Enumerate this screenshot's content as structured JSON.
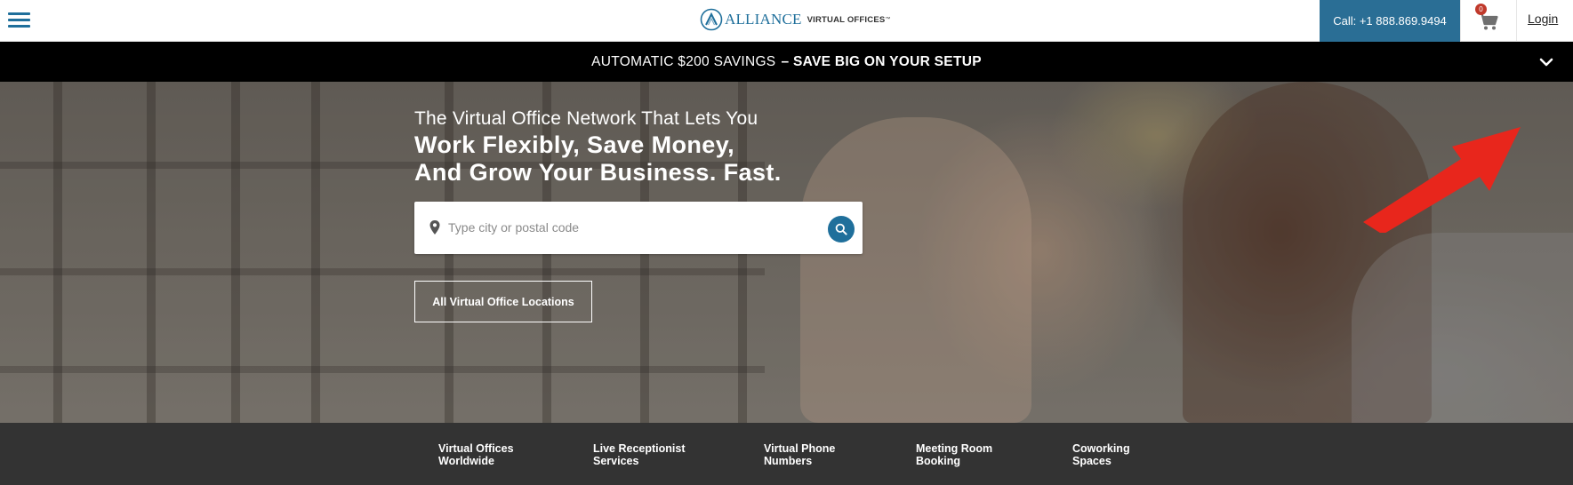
{
  "header": {
    "logo": {
      "brand": "ALLIANCE",
      "sub": "VIRTUAL OFFICES",
      "tm": "™"
    },
    "call_label": "Call: +1 888.869.9494",
    "cart_count": "0",
    "login_label": "Login"
  },
  "promo": {
    "text": "AUTOMATIC $200 SAVINGS",
    "bold": "– SAVE BIG ON YOUR SETUP"
  },
  "hero": {
    "subtitle": "The Virtual Office Network That Lets You",
    "title_line1": "Work Flexibly, Save Money,",
    "title_line2": "And Grow Your Business. Fast.",
    "search": {
      "placeholder": "Type city or postal code",
      "value": ""
    },
    "all_locations_label": "All Virtual Office Locations"
  },
  "services": [
    {
      "line1": "Virtual Offices",
      "line2": "Worldwide"
    },
    {
      "line1": "Live Receptionist",
      "line2": "Services"
    },
    {
      "line1": "Virtual Phone",
      "line2": "Numbers"
    },
    {
      "line1": "Meeting Room",
      "line2": "Booking"
    },
    {
      "line1": "Coworking",
      "line2": "Spaces"
    }
  ],
  "colors": {
    "brand_blue": "#1f6f9b",
    "call_button": "#2a6e95",
    "promo_bg": "#000000",
    "services_bg": "#333333",
    "annotation_arrow": "#e8261c",
    "cart_badge": "#c0392b"
  },
  "icons": {
    "menu": "hamburger-icon",
    "cart": "cart-icon",
    "chevron": "chevron-down-icon",
    "pin": "map-pin-icon",
    "search": "search-icon",
    "annotation": "red-arrow-annotation"
  }
}
